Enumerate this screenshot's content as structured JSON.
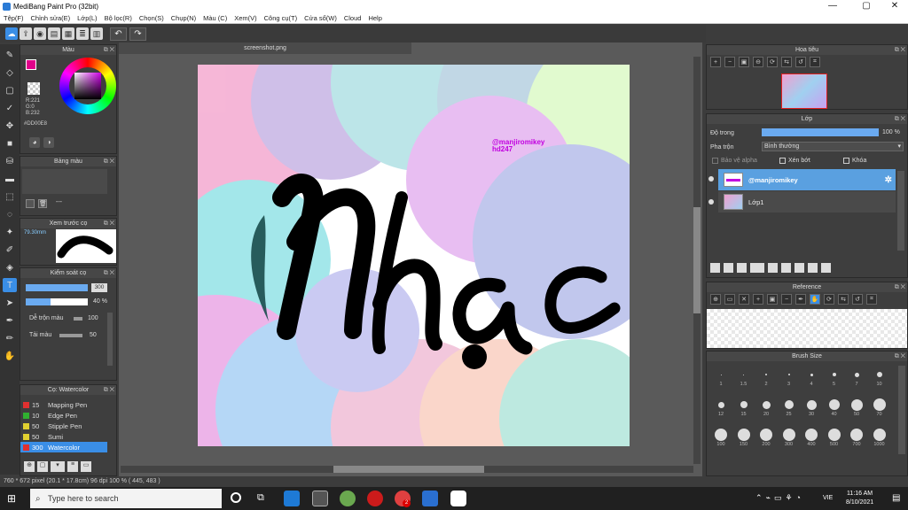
{
  "window": {
    "title": "MediBang Paint Pro (32bit)"
  },
  "menu": [
    "Tệp(F)",
    "Chỉnh sửa(E)",
    "Lớp(L)",
    "Bộ lọc(R)",
    "Chọn(S)",
    "Chụp(N)",
    "Màu (C)",
    "Xem(V)",
    "Công cụ(T)",
    "Cửa sổ(W)",
    "Cloud",
    "Help"
  ],
  "document": {
    "tab": "screenshot.png",
    "signature": "@manjiromikey",
    "signature2": "hd247"
  },
  "color_panel": {
    "title": "Màu",
    "fg_color": "#e0008a",
    "r": "R:221",
    "g": "G:0",
    "b": "B:232",
    "hex": "#DD00E8"
  },
  "palette_panel": {
    "title": "Bảng màu",
    "empty_text": "---"
  },
  "preview_panel": {
    "title": "Xem trước cọ",
    "size": "79.30mm"
  },
  "brush_control": {
    "title": "Kiểm soát cọ",
    "size_value": "300",
    "opacity_value": "40 %",
    "mix_label": "Dễ trộn màu",
    "mix_value": "100",
    "reload_label": "Tải màu",
    "reload_value": "50"
  },
  "brush_list": {
    "title": "Cọ: Watercolor",
    "items": [
      {
        "size": "15",
        "name": "Mapping Pen",
        "color": "#e03030"
      },
      {
        "size": "10",
        "name": "Edge Pen",
        "color": "#30b030"
      },
      {
        "size": "50",
        "name": "Stipple Pen",
        "color": "#e0d030"
      },
      {
        "size": "50",
        "name": "Sumi",
        "color": "#e0d030"
      },
      {
        "size": "300",
        "name": "Watercolor",
        "color": "#e03030"
      }
    ]
  },
  "navigator": {
    "title": "Hoa tiêu"
  },
  "layer_panel": {
    "title": "Lớp",
    "opacity_label": "Độ trong",
    "opacity_value": "100 %",
    "opacity_fraction": 1.0,
    "blend_label": "Pha trộn",
    "blend_value": "Bình thường",
    "protect_alpha": "Bảo vệ alpha",
    "clip": "Xén bớt",
    "lock": "Khóa",
    "layers": [
      {
        "name": "@manjiromikey",
        "selected": true
      },
      {
        "name": "Lớp1",
        "selected": false
      }
    ]
  },
  "reference_panel": {
    "title": "Reference"
  },
  "brush_size_panel": {
    "title": "Brush Size",
    "row1": [
      "1",
      "1.5",
      "2",
      "3",
      "4",
      "5",
      "7",
      "10"
    ],
    "row2": [
      "12",
      "15",
      "20",
      "25",
      "30",
      "40",
      "50",
      "70"
    ],
    "row3": [
      "100",
      "150",
      "200",
      "300",
      "400",
      "500",
      "700",
      "1000"
    ]
  },
  "status": {
    "text": "760 * 672 pixel  (20.1 * 17.8cm)  96 dpi  100 %  ( 445, 483 )"
  },
  "taskbar": {
    "search_placeholder": "Type here to search",
    "lang": "VIE",
    "time": "11:16 AM",
    "date": "8/10/2021",
    "badge": "2"
  }
}
